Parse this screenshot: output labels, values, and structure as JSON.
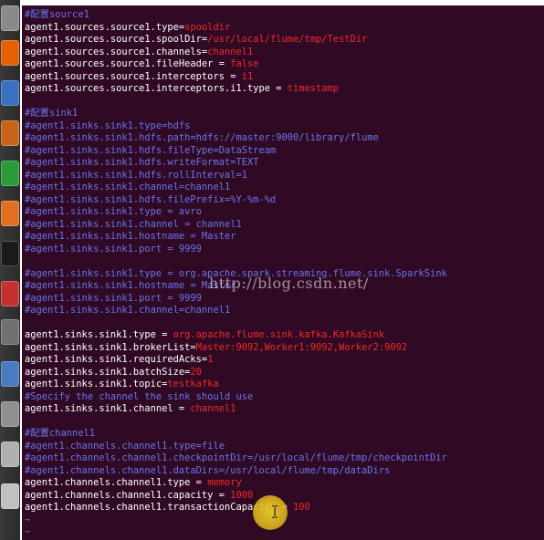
{
  "launcher": {
    "icons": [
      "files-icon",
      "firefox-icon",
      "writer-icon",
      "impress-icon",
      "calc-icon",
      "software-center-icon",
      "terminal-icon",
      "settings-icon",
      "tools-icon",
      "remote-icon",
      "network-icon",
      "drive-icon",
      "disc-icon"
    ]
  },
  "editor": {
    "lines": [
      [
        {
          "t": "#配置source1",
          "k": "cmt"
        }
      ],
      [
        {
          "t": "agent1.sources.source1.type=",
          "k": "key"
        },
        {
          "t": "spooldir",
          "k": "val"
        }
      ],
      [
        {
          "t": "agent1.sources.source1.spoolDir=",
          "k": "key"
        },
        {
          "t": "/usr/local/flume/tmp/TestDir",
          "k": "val"
        }
      ],
      [
        {
          "t": "agent1.sources.source1.channels=",
          "k": "key"
        },
        {
          "t": "channel1",
          "k": "val"
        }
      ],
      [
        {
          "t": "agent1.sources.source1.fileHeader = ",
          "k": "key"
        },
        {
          "t": "false",
          "k": "val"
        }
      ],
      [
        {
          "t": "agent1.sources.source1.interceptors = ",
          "k": "key"
        },
        {
          "t": "i1",
          "k": "val"
        }
      ],
      [
        {
          "t": "agent1.sources.source1.interceptors.i1.type = ",
          "k": "key"
        },
        {
          "t": "timestamp",
          "k": "val"
        }
      ],
      [],
      [
        {
          "t": "#配置sink1",
          "k": "cmt"
        }
      ],
      [
        {
          "t": "#agent1.sinks.sink1.type=hdfs",
          "k": "cmt"
        }
      ],
      [
        {
          "t": "#agent1.sinks.sink1.hdfs.path=hdfs://master:9000/library/flume",
          "k": "cmt"
        }
      ],
      [
        {
          "t": "#agent1.sinks.sink1.hdfs.fileType=DataStream",
          "k": "cmt"
        }
      ],
      [
        {
          "t": "#agent1.sinks.sink1.hdfs.writeFormat=TEXT",
          "k": "cmt"
        }
      ],
      [
        {
          "t": "#agent1.sinks.sink1.hdfs.rollInterval=1",
          "k": "cmt"
        }
      ],
      [
        {
          "t": "#agent1.sinks.sink1.channel=channel1",
          "k": "cmt"
        }
      ],
      [
        {
          "t": "#agent1.sinks.sink1.hdfs.filePrefix=%Y-%m-%d",
          "k": "cmt"
        }
      ],
      [
        {
          "t": "#agent1.sinks.sink1.type = avro",
          "k": "cmt"
        }
      ],
      [
        {
          "t": "#agent1.sinks.sink1.channel = channel1",
          "k": "cmt"
        }
      ],
      [
        {
          "t": "#agent1.sinks.sink1.hostname = Master",
          "k": "cmt"
        }
      ],
      [
        {
          "t": "#agent1.sinks.sink1.port = 9999",
          "k": "cmt"
        }
      ],
      [],
      [
        {
          "t": "#agent1.sinks.sink1.type = org.apache.spark.streaming.flume.sink.SparkSink",
          "k": "cmt"
        }
      ],
      [
        {
          "t": "#agent1.sinks.sink1.hostname = Master",
          "k": "cmt"
        }
      ],
      [
        {
          "t": "#agent1.sinks.sink1.port = 9999",
          "k": "cmt"
        }
      ],
      [
        {
          "t": "#agent1.sinks.sink1.channel=channel1",
          "k": "cmt"
        }
      ],
      [],
      [
        {
          "t": "agent1.sinks.sink1.type = ",
          "k": "key"
        },
        {
          "t": "org.apache.flume.sink.kafka.KafkaSink",
          "k": "val"
        }
      ],
      [
        {
          "t": "agent1.sinks.sink1.brokerList=",
          "k": "key"
        },
        {
          "t": "Master:9092,Worker1:9092,Worker2:9092",
          "k": "val"
        }
      ],
      [
        {
          "t": "agent1.sinks.sink1.requiredAcks=",
          "k": "key"
        },
        {
          "t": "1",
          "k": "val"
        }
      ],
      [
        {
          "t": "agent1.sinks.sink1.batchSize=",
          "k": "key"
        },
        {
          "t": "20",
          "k": "val"
        }
      ],
      [
        {
          "t": "agent1.sinks.sink1.topic=",
          "k": "key"
        },
        {
          "t": "testkafka",
          "k": "val"
        }
      ],
      [
        {
          "t": "#Specify the channel the sink should use",
          "k": "cmt"
        }
      ],
      [
        {
          "t": "agent1.sinks.sink1.channel = ",
          "k": "key"
        },
        {
          "t": "channel1",
          "k": "val"
        }
      ],
      [],
      [
        {
          "t": "#配置channel1",
          "k": "cmt"
        }
      ],
      [
        {
          "t": "#agent1.channels.channel1.type=file",
          "k": "cmt"
        }
      ],
      [
        {
          "t": "#agent1.channels.channel1.checkpointDir=/usr/local/flume/tmp/checkpointDir",
          "k": "cmt"
        }
      ],
      [
        {
          "t": "#agent1.channels.channel1.dataDirs=/usr/local/flume/tmp/dataDirs",
          "k": "cmt"
        }
      ],
      [
        {
          "t": "agent1.channels.channel1.type = ",
          "k": "key"
        },
        {
          "t": "memory",
          "k": "val"
        }
      ],
      [
        {
          "t": "agent1.channels.channel1.capacity = ",
          "k": "key"
        },
        {
          "t": "1000",
          "k": "val"
        }
      ],
      [
        {
          "t": "agent1.channels.channel1.transactionCapacity = ",
          "k": "key"
        },
        {
          "t": "100",
          "k": "val"
        }
      ],
      [
        {
          "t": "~",
          "k": "tilde"
        }
      ],
      [
        {
          "t": "~",
          "k": "tilde"
        }
      ]
    ]
  },
  "watermark": "http://blog.csdn.net/",
  "colors": {
    "terminal_bg": "#300a24",
    "key": "#ffffff",
    "value": "#ef2929",
    "comment": "#6a74ec",
    "cursor_highlight": "#ebcd28"
  }
}
